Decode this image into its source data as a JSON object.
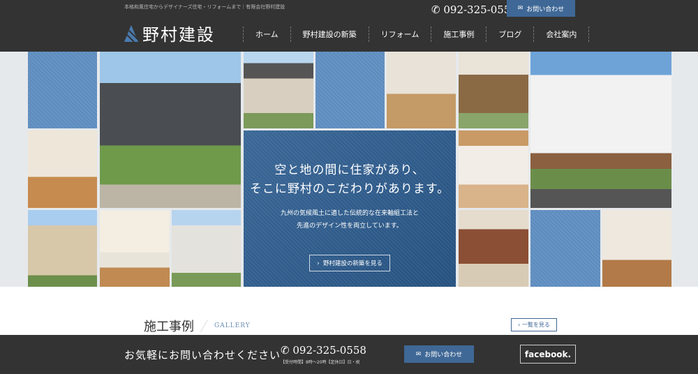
{
  "header": {
    "tagline": "本格和風住宅からデザイナーズ住宅・リフォームまで｜有限会社野村建設",
    "phone": "092-325-0558",
    "contact_label": "お問い合わせ",
    "logo_text": "野村建設",
    "nav": [
      {
        "label": "ホーム"
      },
      {
        "label": "野村建設の新築"
      },
      {
        "label": "リフォーム"
      },
      {
        "label": "施工事例"
      },
      {
        "label": "ブログ"
      },
      {
        "label": "会社案内"
      }
    ]
  },
  "hero": {
    "headline_1": "空と地の間に住家があり、",
    "headline_2": "そこに野村のこだわりがあります。",
    "body_1": "九州の気候風土に適した伝統的な在来軸組工法と",
    "body_2": "先進のデザイン性を両立しています。",
    "button_label": "野村建設の新築を見る"
  },
  "gallery": {
    "title": "施工事例",
    "subtitle": "GALLERY",
    "more_label": "一覧を見る"
  },
  "footer": {
    "message": "お気軽にお問い合わせください",
    "phone": "092-325-0558",
    "hours": "【受付時間】8時～20時【定休日】日・祝",
    "contact_label": "お問い合わせ",
    "facebook_label": "facebook."
  },
  "colors": {
    "accent": "#3f6896",
    "dark": "#333333",
    "tile_blue": "#5d8cbf"
  }
}
